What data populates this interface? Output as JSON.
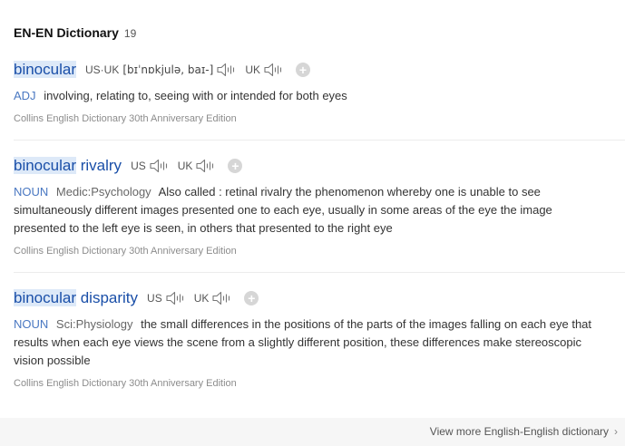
{
  "header": {
    "title": "EN-EN Dictionary",
    "count": "19"
  },
  "entries": [
    {
      "word_hl": "binocular",
      "word_rest": "",
      "pron_label": "US·UK",
      "phonetic": "[bɪˈnɒkjulə, baɪ-]",
      "uk_label": "UK",
      "pos": "ADJ",
      "domain": "",
      "definition": "involving, relating to, seeing with or intended for both eyes",
      "source": "Collins English Dictionary 30th Anniversary Edition"
    },
    {
      "word_hl": "binocular",
      "word_rest": " rivalry",
      "pron_label": "US",
      "uk_label": "UK",
      "pos": "NOUN",
      "domain": "Medic:Psychology",
      "definition": "Also called : retinal rivalry the phenomenon whereby one is unable to see simultaneously different images presented one to each eye, usually in some areas of the eye the image presented to the left eye is seen, in others that presented to the right eye",
      "source": "Collins English Dictionary 30th Anniversary Edition"
    },
    {
      "word_hl": "binocular",
      "word_rest": " disparity",
      "pron_label": "US",
      "uk_label": "UK",
      "pos": "NOUN",
      "domain": "Sci:Physiology",
      "definition": "the small differences in the positions of the parts of the images falling on each eye that results when each eye views the scene from a slightly different position, these differences make stereoscopic vision possible",
      "source": "Collins English Dictionary 30th Anniversary Edition"
    }
  ],
  "footer": {
    "view_more": "View more English-English dictionary",
    "chevron": "›"
  },
  "icons": {
    "speaker": "speaker-icon",
    "add": "plus-icon",
    "chevron": "chevron-right-icon"
  },
  "colors": {
    "word": "#1a4fa8",
    "highlight": "#dde9f8",
    "pos": "#4a78c2"
  }
}
